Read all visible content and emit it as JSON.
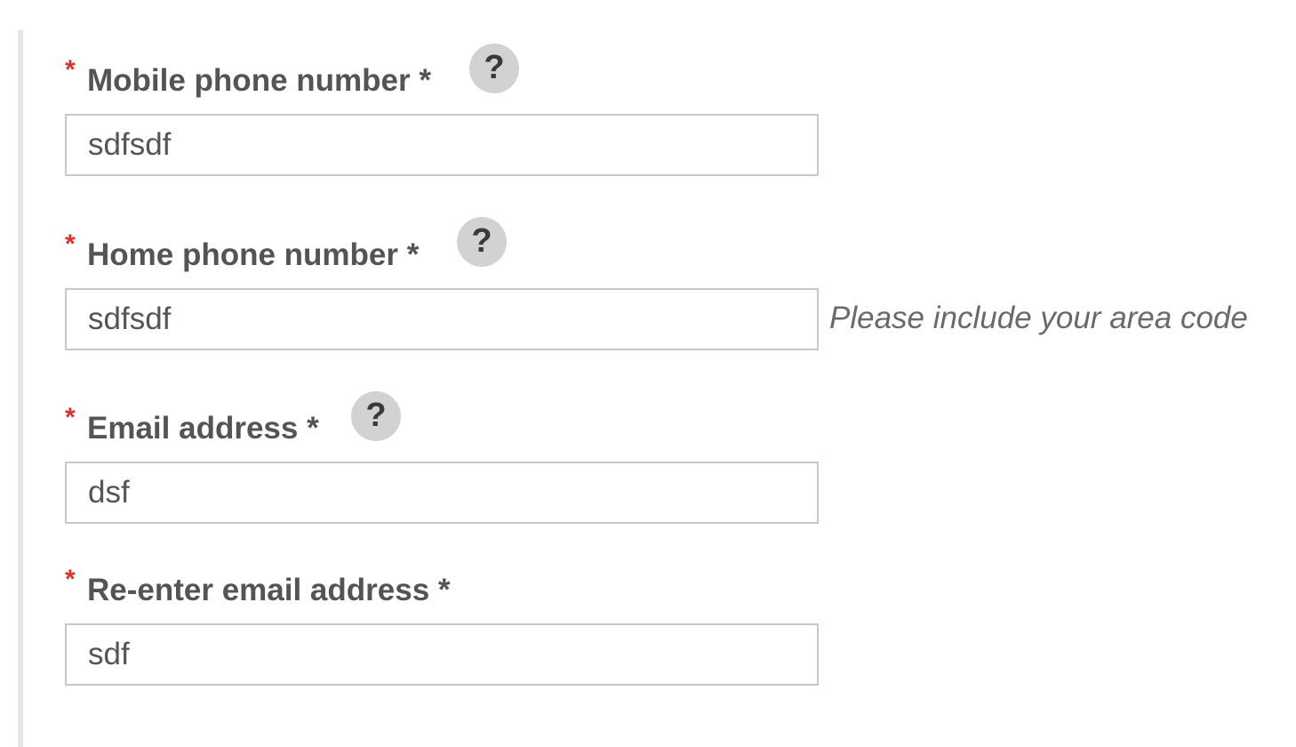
{
  "form": {
    "mobile": {
      "required_marker": "*",
      "label": "Mobile phone number *",
      "help_icon": "?",
      "value": "sdfsdf"
    },
    "home": {
      "required_marker": "*",
      "label": "Home phone number *",
      "help_icon": "?",
      "value": "sdfsdf",
      "hint": "Please include your area code"
    },
    "email": {
      "required_marker": "*",
      "label": "Email address *",
      "help_icon": "?",
      "value": "dsf"
    },
    "reenter_email": {
      "required_marker": "*",
      "label": "Re-enter email address *",
      "value": "sdf"
    }
  },
  "colors": {
    "required_star": "#d8332a",
    "label_text": "#545454",
    "help_icon_bg": "#d2d2d2",
    "input_border": "#c8c8c8",
    "hint_text": "#6a6a6a"
  },
  "icons": {
    "help": "question-mark-icon"
  }
}
